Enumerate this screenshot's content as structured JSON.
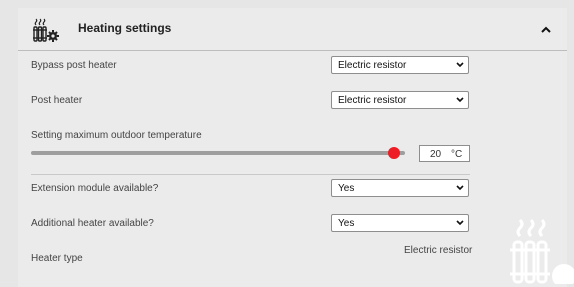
{
  "header": {
    "title": "Heating settings",
    "icon": "radiator-gear-icon",
    "collapse_icon": "chevron-up-icon"
  },
  "rows": {
    "bypass_post_heater": {
      "label": "Bypass post heater",
      "value": "Electric resistor"
    },
    "post_heater": {
      "label": "Post heater",
      "value": "Electric resistor"
    },
    "max_outdoor_temp": {
      "label": "Setting maximum outdoor temperature",
      "value": "20",
      "unit": "°C",
      "slider_fraction": 0.97
    },
    "extension_module": {
      "label": "Extension module available?",
      "value": "Yes"
    },
    "additional_heater": {
      "label": "Additional heater available?",
      "value": "Yes"
    },
    "heater_type": {
      "label": "Heater type",
      "value": "Electric resistor"
    }
  },
  "colors": {
    "accent": "#ee1c25",
    "background": "#ebebeb",
    "track": "#9e9e9e"
  },
  "background_icon": "radiator-watermark-icon"
}
